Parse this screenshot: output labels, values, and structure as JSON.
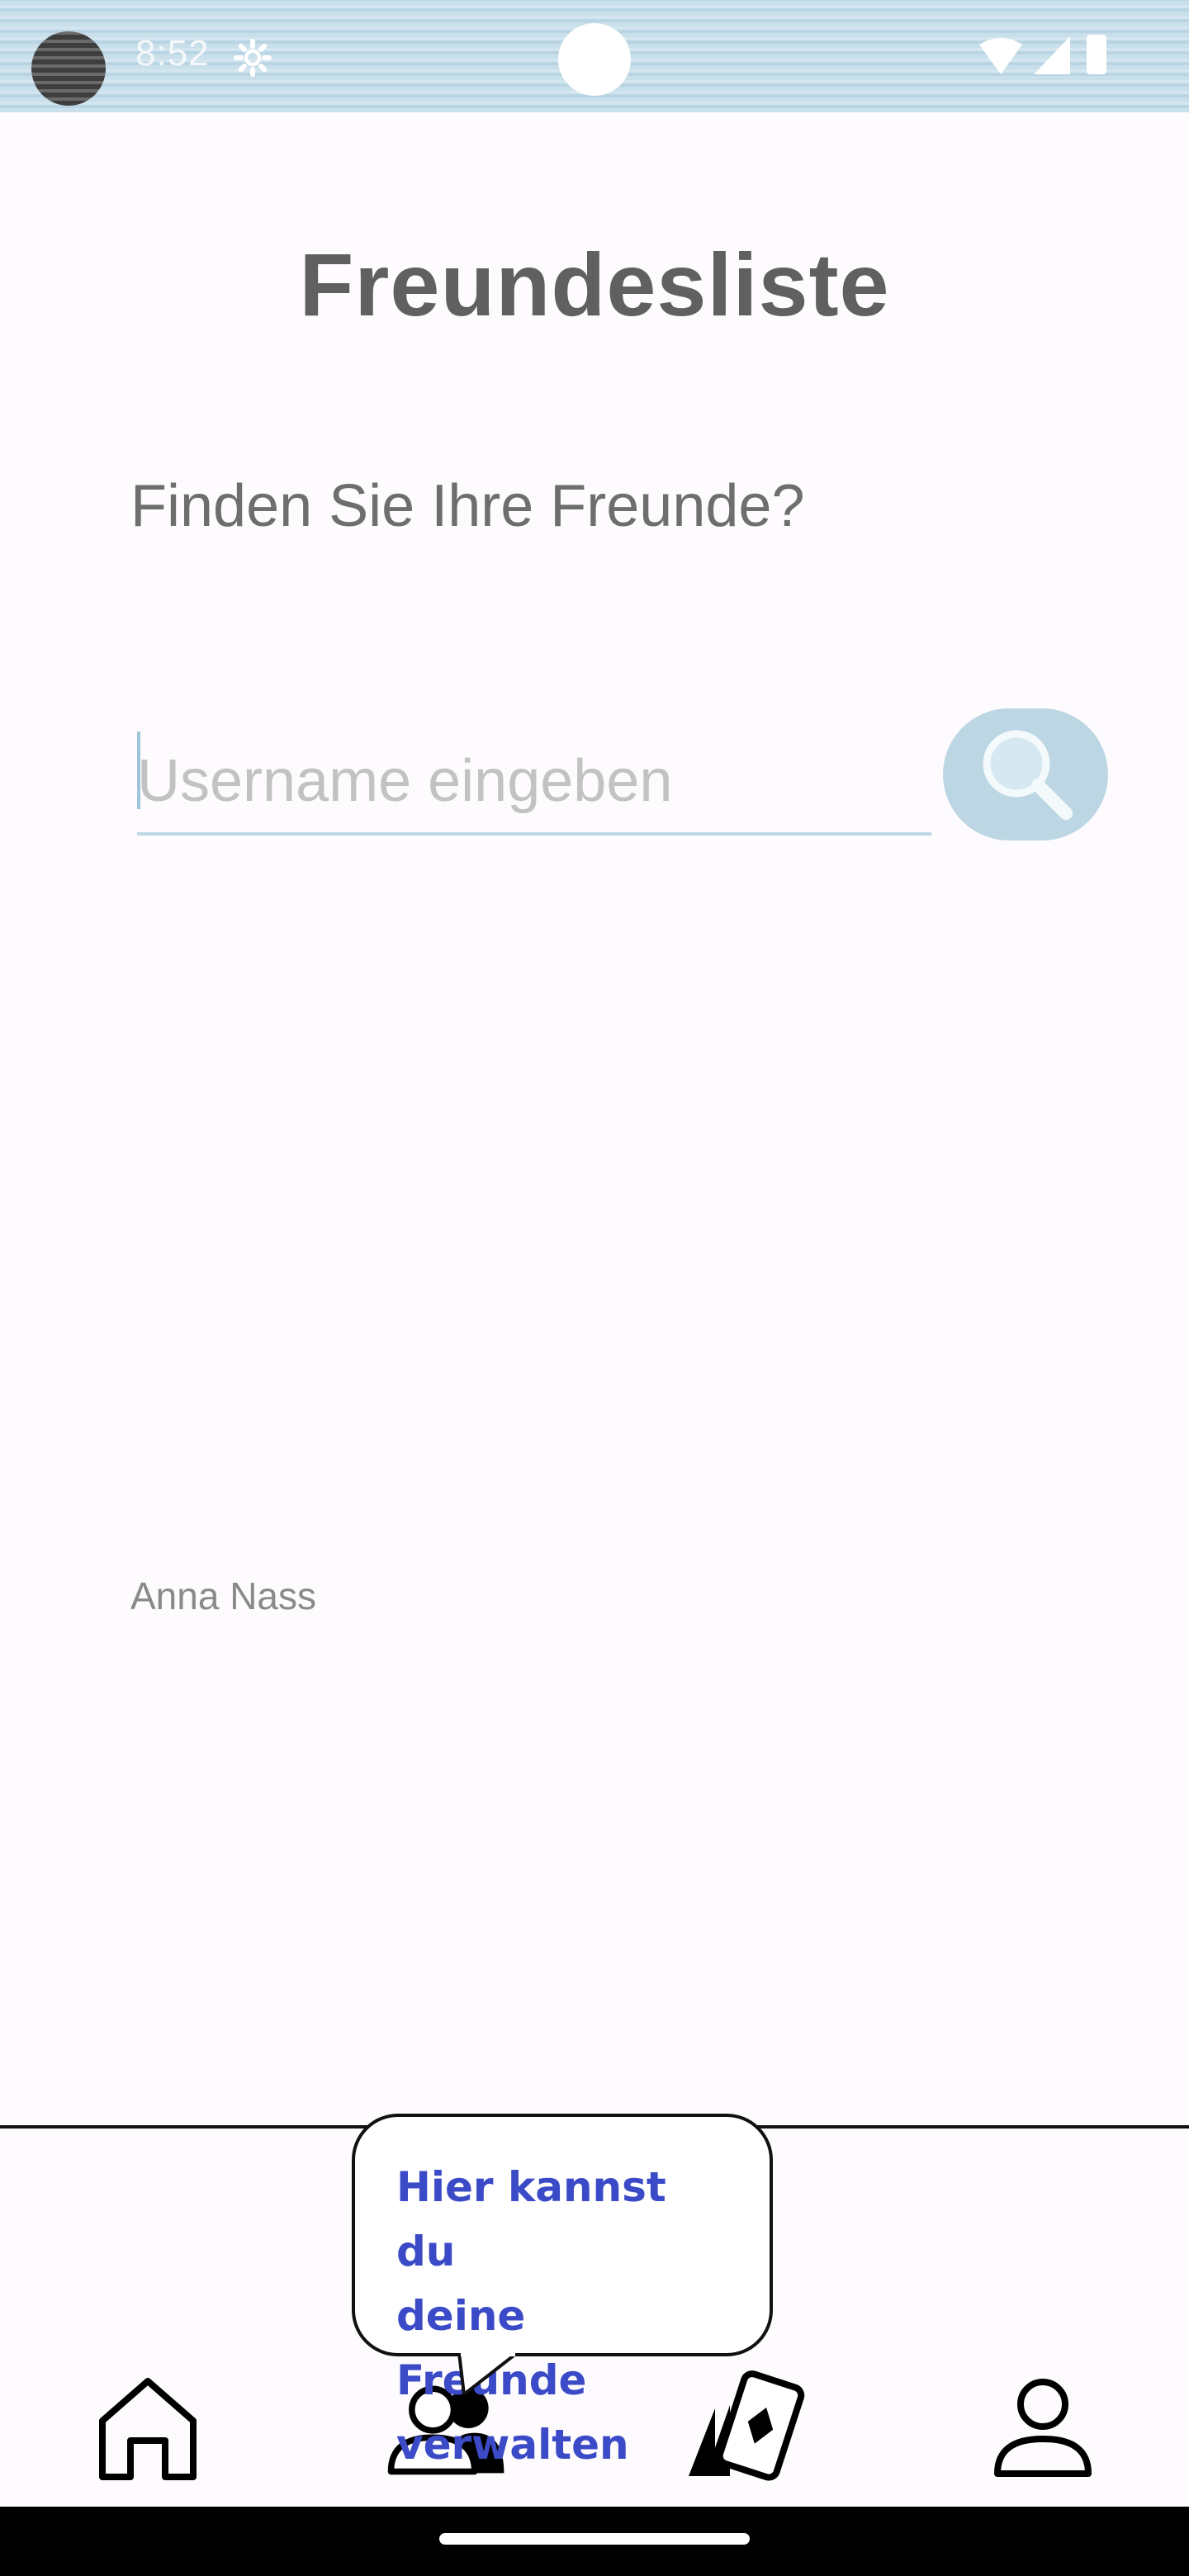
{
  "status_bar": {
    "time": "8:52",
    "icons": [
      "avatar-icon",
      "gear-icon",
      "wifi-icon",
      "signal-icon",
      "battery-icon"
    ]
  },
  "page": {
    "title": "Freundesliste",
    "subtitle": "Finden Sie Ihre Freunde?"
  },
  "search": {
    "placeholder": "Username eingeben",
    "value": "",
    "button_icon": "search-icon"
  },
  "friends": {
    "items": [
      {
        "name": "Anna Nass"
      }
    ]
  },
  "tooltip": {
    "lines": [
      "Hier kannst du",
      "deine Freunde",
      "verwalten"
    ]
  },
  "bottom_nav": {
    "items": [
      {
        "icon": "home-icon"
      },
      {
        "icon": "friends-icon"
      },
      {
        "icon": "cards-icon"
      },
      {
        "icon": "profile-icon"
      }
    ]
  },
  "colors": {
    "status_bar_bg": "#c9dfea",
    "accent": "#bcd6e4",
    "tooltip_text": "#3b4bc8",
    "title_text": "#606060"
  }
}
